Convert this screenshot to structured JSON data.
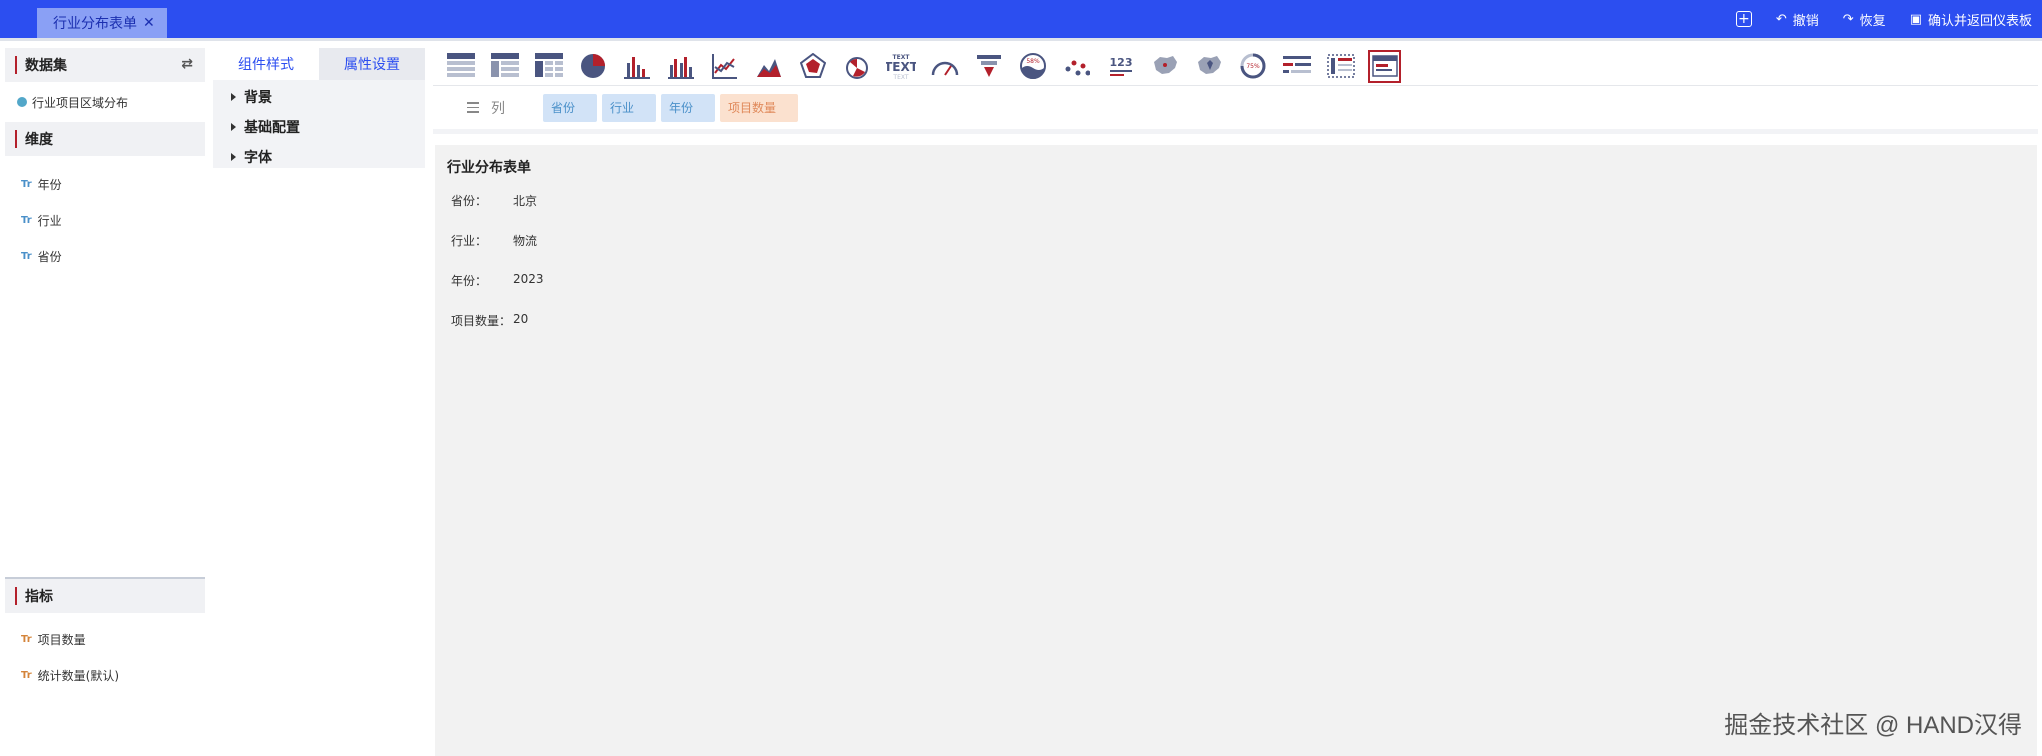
{
  "tab": {
    "title": "行业分布表单",
    "close": "✕"
  },
  "top_actions": {
    "undo": "撤销",
    "redo": "恢复",
    "confirm": "确认并返回仪表板"
  },
  "dataset": {
    "header": "数据集",
    "item": "行业项目区域分布",
    "dimension_header": "维度",
    "dimensions": [
      "年份",
      "行业",
      "省份"
    ],
    "metric_header": "指标",
    "metrics": [
      "项目数量",
      "统计数量(默认)"
    ],
    "type_label": "Tr"
  },
  "style_panel": {
    "tabs": [
      "组件样式",
      "属性设置"
    ],
    "props": [
      "背景",
      "基础配置",
      "字体"
    ]
  },
  "toolbar": {
    "icons": [
      "table-icon",
      "grouped-table-icon",
      "cross-table-icon",
      "pie-chart-icon",
      "bar-chart-icon",
      "grouped-bar-icon",
      "line-chart-icon",
      "area-chart-icon",
      "radar-chart-icon",
      "rose-chart-icon",
      "text-widget-icon",
      "gauge-icon",
      "funnel-icon",
      "water-ball-icon",
      "scatter-icon",
      "number-card-icon",
      "map-icon",
      "map-marker-icon",
      "ring-progress-icon",
      "ranking-icon",
      "detail-table-icon",
      "form-card-icon"
    ],
    "text_icon_top": "TEXT",
    "text_icon_main": "TEXT",
    "number_icon": "123",
    "water_percent": "58%",
    "ring_percent": "75%"
  },
  "columns": {
    "label": "列",
    "chips": [
      {
        "text": "省份",
        "kind": "blue"
      },
      {
        "text": "行业",
        "kind": "blue"
      },
      {
        "text": "年份",
        "kind": "blue"
      },
      {
        "text": "项目数量",
        "kind": "orange"
      }
    ]
  },
  "card": {
    "title": "行业分布表单",
    "rows": [
      {
        "key": "省份：",
        "value": "北京"
      },
      {
        "key": "行业：",
        "value": "物流"
      },
      {
        "key": "年份：",
        "value": "2023"
      },
      {
        "key": "项目数量：",
        "value": "20"
      }
    ]
  },
  "watermark": "掘金技术社区 @ HAND汉得",
  "colors": {
    "topbar": "#2c4ef0",
    "accent_red": "#b3202b",
    "chip_blue": "#d2e3f7",
    "chip_orange": "#fbe1cf"
  }
}
